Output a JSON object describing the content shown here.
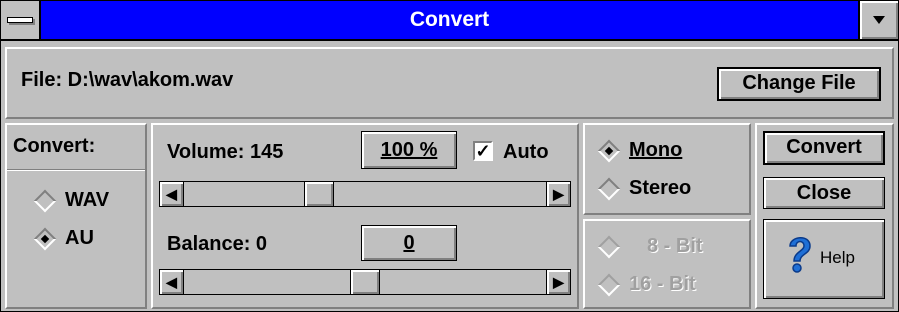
{
  "window": {
    "title": "Convert"
  },
  "file": {
    "label": "File: D:\\wav\\akom.wav",
    "change_button": "Change File"
  },
  "format": {
    "heading": "Convert:",
    "options": [
      {
        "label": "WAV",
        "selected": false
      },
      {
        "label": "AU",
        "selected": true
      }
    ]
  },
  "volume": {
    "label": "Volume: 145",
    "reset_button": "100 %",
    "auto_label": "Auto",
    "auto_checked": true,
    "level": 0.36
  },
  "balance": {
    "label": "Balance: 0",
    "reset_button": "0",
    "level": 0.5
  },
  "channels": {
    "options": [
      {
        "label": "Mono",
        "selected": true
      },
      {
        "label": "Stereo",
        "selected": false
      }
    ]
  },
  "bits": {
    "options": [
      {
        "label": "8 - Bit",
        "enabled": false
      },
      {
        "label": "16 - Bit",
        "enabled": false
      }
    ]
  },
  "actions": {
    "convert": "Convert",
    "close": "Close",
    "help": "Help"
  },
  "colors": {
    "title_bar": "#0000ff",
    "face": "#c0c0c0",
    "help_icon": "#1f6fd6"
  }
}
